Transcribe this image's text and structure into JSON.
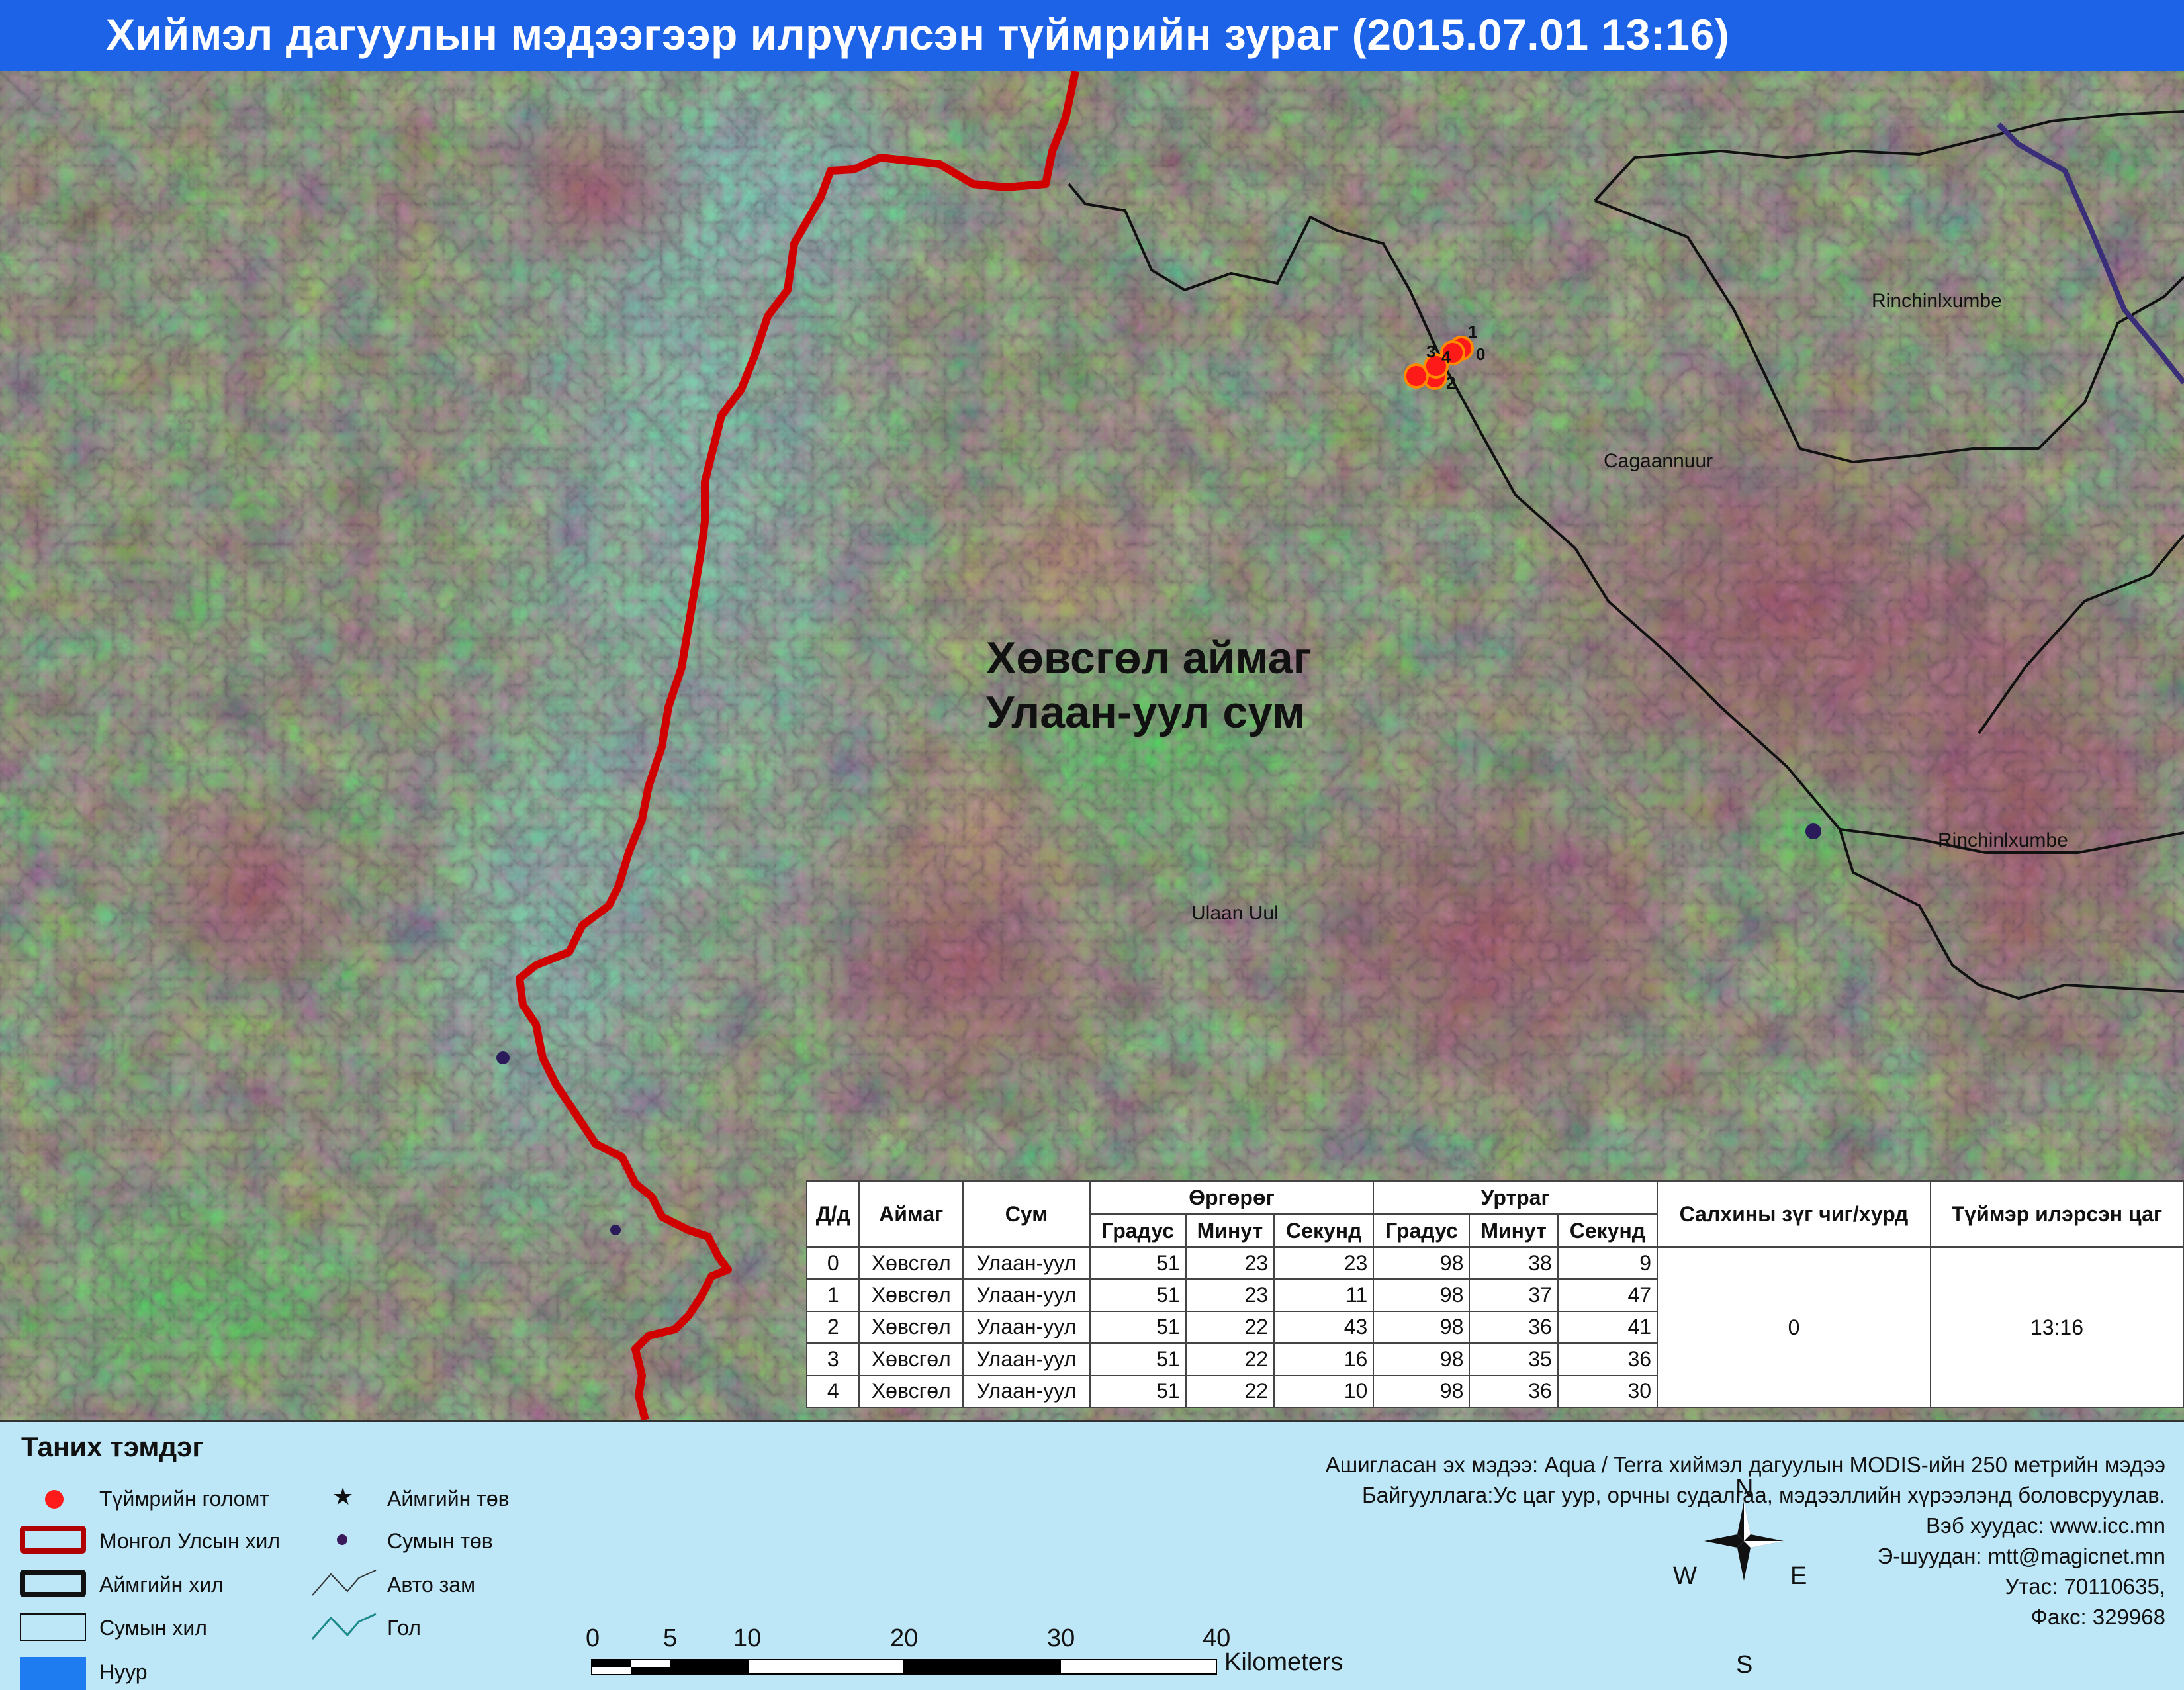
{
  "title": "Хиймэл дагуулын мэдээгээр илрүүлсэн түймрийн зураг  (2015.07.01 13:16)",
  "map_labels": {
    "aimag": "Хөвсгөл аймаг",
    "sum": "Улаан-уул сум",
    "rinchin_north": "Rinchinlxumbe",
    "rinchin_south": "Rinchinlxumbe",
    "cagaannuur": "Cagaannuur",
    "ulaan_uul": "Ulaan Uul"
  },
  "fire_points": [
    {
      "id": "0",
      "label": "0"
    },
    {
      "id": "1",
      "label": "1"
    },
    {
      "id": "2",
      "label": "2"
    },
    {
      "id": "3",
      "label": "3"
    },
    {
      "id": "4",
      "label": "4"
    }
  ],
  "table": {
    "headers": {
      "dd": "Д/д",
      "aimag": "Аймаг",
      "sum": "Сум",
      "lat": "Өргөрөг",
      "lon": "Уртраг",
      "wind": "Салхины зүг чиг/хурд",
      "time": "Түймэр илэрсэн цаг",
      "deg": "Градус",
      "min": "Минут",
      "sec": "Секунд"
    },
    "rows": [
      {
        "dd": "0",
        "aimag": "Хөвсгөл",
        "sum": "Улаан-уул",
        "lat_d": "51",
        "lat_m": "23",
        "lat_s": "23",
        "lon_d": "98",
        "lon_m": "38",
        "lon_s": "9"
      },
      {
        "dd": "1",
        "aimag": "Хөвсгөл",
        "sum": "Улаан-уул",
        "lat_d": "51",
        "lat_m": "23",
        "lat_s": "11",
        "lon_d": "98",
        "lon_m": "37",
        "lon_s": "47"
      },
      {
        "dd": "2",
        "aimag": "Хөвсгөл",
        "sum": "Улаан-уул",
        "lat_d": "51",
        "lat_m": "22",
        "lat_s": "43",
        "lon_d": "98",
        "lon_m": "36",
        "lon_s": "41"
      },
      {
        "dd": "3",
        "aimag": "Хөвсгөл",
        "sum": "Улаан-уул",
        "lat_d": "51",
        "lat_m": "22",
        "lat_s": "16",
        "lon_d": "98",
        "lon_m": "35",
        "lon_s": "36"
      },
      {
        "dd": "4",
        "aimag": "Хөвсгөл",
        "sum": "Улаан-уул",
        "lat_d": "51",
        "lat_m": "22",
        "lat_s": "10",
        "lon_d": "98",
        "lon_m": "36",
        "lon_s": "30"
      }
    ],
    "wind": "0",
    "time": "13:16"
  },
  "legend": {
    "title": "Таних тэмдэг",
    "fire": "Түймрийн голомт",
    "national_border": "Монгол Улсын хил",
    "aimag_border": "Аймгийн хил",
    "sum_border": "Сумын хил",
    "lake": "Нуур",
    "aimag_center": "Аймгийн төв",
    "sum_center": "Сумын төв",
    "road": "Авто зам",
    "river": "Гол"
  },
  "source": {
    "line1": "Ашигласан эх мэдээ: Aqua / Terra хиймэл дагуулын MODIS-ийн 250 метрийн мэдээ",
    "line2": "Байгууллага:Ус цаг уур, орчны судалгаа, мэдээллийн хүрээлэнд боловсруулав.",
    "line3": "Вэб хуудас: www.icc.mn",
    "line4": "Э-шуудан: mtt@magicnet.mn",
    "line5": "Утас: 70110635,",
    "line6": "Факс: 329968"
  },
  "scale": {
    "ticks": [
      "0",
      "5",
      "10",
      "20",
      "30",
      "40"
    ],
    "unit": "Kilometers"
  },
  "compass": {
    "n": "N",
    "s": "S",
    "e": "E",
    "w": "W"
  },
  "colors": {
    "title_bg": "#1d63e8",
    "fire": "#ff1a1a",
    "national_border": "#c40000",
    "legend_bg": "#bde6f7",
    "lake": "#1e7bf0"
  }
}
